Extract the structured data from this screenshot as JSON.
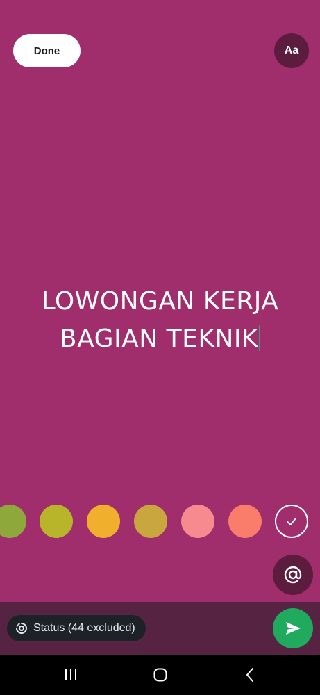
{
  "header": {
    "done_label": "Done",
    "font_label": "Aa"
  },
  "status": {
    "lines": [
      "LOWONGAN KERJA",
      "BAGIAN TEKNIK"
    ],
    "background_color": "#a02d6c"
  },
  "palette": {
    "colors": [
      "#8fa83c",
      "#b8b52a",
      "#f0b02e",
      "#c9a63e",
      "#f78a8e",
      "#fa7d6b"
    ],
    "confirm_icon": "check-icon"
  },
  "mention": {
    "icon": "at-icon"
  },
  "footer": {
    "audience_icon": "status-ring-icon",
    "audience_label": "Status (44 excluded)",
    "send_icon": "send-icon"
  },
  "system_nav": {
    "items": [
      "recent-apps-icon",
      "home-icon",
      "back-icon"
    ]
  }
}
